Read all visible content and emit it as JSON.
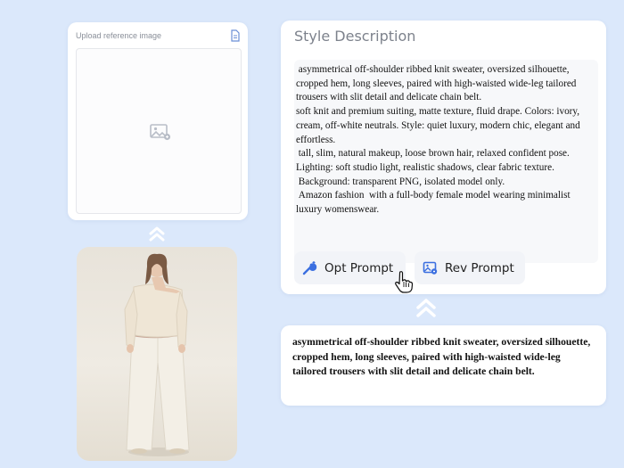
{
  "upload": {
    "title": "Upload reference image",
    "file_icon": "file-icon",
    "placeholder_icon": "image-placeholder-icon"
  },
  "photo": {
    "alt": "model-photo"
  },
  "style": {
    "title": "Style Description",
    "description": " asymmetrical off-shoulder ribbed knit sweater, oversized silhouette,\ncropped hem, long sleeves, paired with high-waisted wide-leg tailored\ntrousers with slit detail and delicate chain belt.\nsoft knit and premium suiting, matte texture, fluid drape. Colors: ivory,\ncream, off-white neutrals. Style: quiet luxury, modern chic, elegant and\neffortless.\n tall, slim, natural makeup, loose brown hair, relaxed confident pose.\nLighting: soft studio light, realistic shadows, clear fabric texture.\n Background: transparent PNG, isolated model only.\n Amazon fashion  with a full-body female model wearing minimalist\nluxury womenswear."
  },
  "buttons": {
    "opt_label": "Opt Prompt",
    "rev_label": "Rev Prompt"
  },
  "result": {
    "text": "asymmetrical off-shoulder ribbed knit sweater, oversized silhouette, cropped hem, long sleeves, paired with high-waisted wide-leg tailored trousers with slit detail and delicate chain belt."
  },
  "colors": {
    "background": "#dbe8fb",
    "accent": "#3b6fe0",
    "chevron": "#ffffff"
  }
}
